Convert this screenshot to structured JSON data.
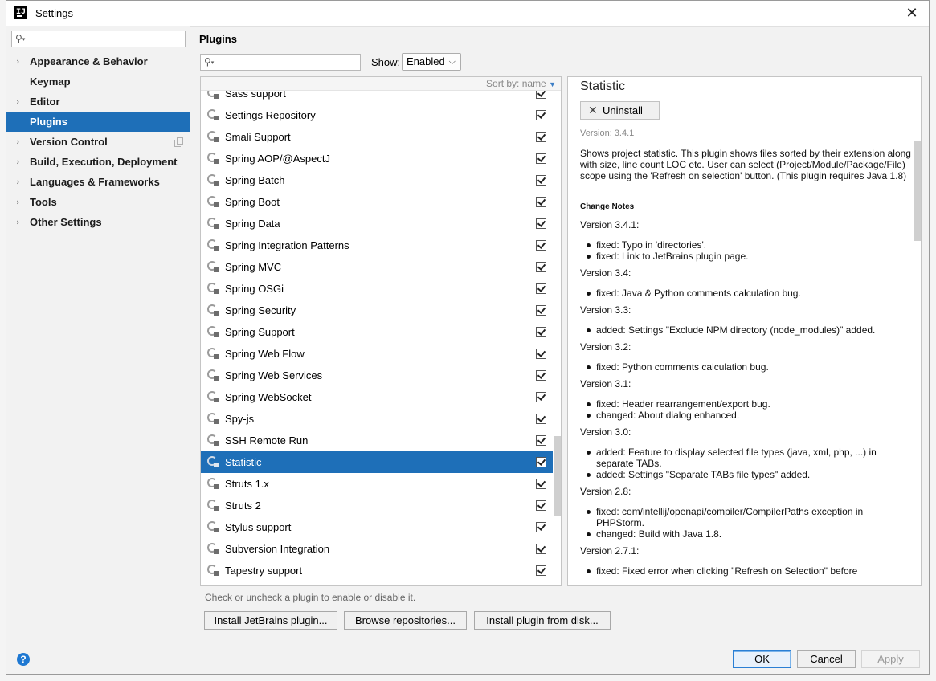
{
  "window": {
    "title": "Settings"
  },
  "sidebar": {
    "search_placeholder": "",
    "items": [
      {
        "label": "Appearance & Behavior",
        "expandable": true
      },
      {
        "label": "Keymap",
        "expandable": false
      },
      {
        "label": "Editor",
        "expandable": true
      },
      {
        "label": "Plugins",
        "expandable": false,
        "selected": true
      },
      {
        "label": "Version Control",
        "expandable": true
      },
      {
        "label": "Build, Execution, Deployment",
        "expandable": true
      },
      {
        "label": "Languages & Frameworks",
        "expandable": true
      },
      {
        "label": "Tools",
        "expandable": true
      },
      {
        "label": "Other Settings",
        "expandable": true
      }
    ]
  },
  "plugins": {
    "title": "Plugins",
    "search_placeholder": "",
    "show_label": "Show:",
    "show_value": "Enabled",
    "sort_label": "Sort by: name",
    "items": [
      {
        "name": "Sass support",
        "enabled": true
      },
      {
        "name": "Settings Repository",
        "enabled": true
      },
      {
        "name": "Smali Support",
        "enabled": true
      },
      {
        "name": "Spring AOP/@AspectJ",
        "enabled": true
      },
      {
        "name": "Spring Batch",
        "enabled": true
      },
      {
        "name": "Spring Boot",
        "enabled": true
      },
      {
        "name": "Spring Data",
        "enabled": true
      },
      {
        "name": "Spring Integration Patterns",
        "enabled": true
      },
      {
        "name": "Spring MVC",
        "enabled": true
      },
      {
        "name": "Spring OSGi",
        "enabled": true
      },
      {
        "name": "Spring Security",
        "enabled": true
      },
      {
        "name": "Spring Support",
        "enabled": true
      },
      {
        "name": "Spring Web Flow",
        "enabled": true
      },
      {
        "name": "Spring Web Services",
        "enabled": true
      },
      {
        "name": "Spring WebSocket",
        "enabled": true
      },
      {
        "name": "Spy-js",
        "enabled": true
      },
      {
        "name": "SSH Remote Run",
        "enabled": true
      },
      {
        "name": "Statistic",
        "enabled": true,
        "selected": true
      },
      {
        "name": "Struts 1.x",
        "enabled": true
      },
      {
        "name": "Struts 2",
        "enabled": true
      },
      {
        "name": "Stylus support",
        "enabled": true
      },
      {
        "name": "Subversion Integration",
        "enabled": true
      },
      {
        "name": "Tapestry support",
        "enabled": true
      }
    ],
    "hint": "Check or uncheck a plugin to enable or disable it.",
    "buttons": {
      "install_jetbrains": "Install JetBrains plugin...",
      "browse": "Browse repositories...",
      "install_disk": "Install plugin from disk..."
    }
  },
  "detail": {
    "title": "Statistic",
    "uninstall_label": "Uninstall",
    "version": "Version: 3.4.1",
    "description": "Shows project statistic. This plugin shows files sorted by their extension along with size, line count LOC etc. User can select (Project/Module/Package/File) scope using the 'Refresh on selection' button. (This plugin requires Java 1.8)",
    "change_notes_title": "Change Notes",
    "changes": [
      {
        "version": "Version 3.4.1:",
        "notes": [
          "fixed: Typo in 'directories'.",
          "fixed: Link to JetBrains plugin page."
        ]
      },
      {
        "version": "Version 3.4:",
        "notes": [
          "fixed: Java & Python comments calculation bug."
        ]
      },
      {
        "version": "Version 3.3:",
        "notes": [
          "added: Settings \"Exclude NPM directory (node_modules)\" added."
        ]
      },
      {
        "version": "Version 3.2:",
        "notes": [
          "fixed: Python comments calculation bug."
        ]
      },
      {
        "version": "Version 3.1:",
        "notes": [
          "fixed: Header rearrangement/export bug.",
          "changed: About dialog enhanced."
        ]
      },
      {
        "version": "Version 3.0:",
        "notes": [
          "added: Feature to display selected file types (java, xml, php, ...) in separate TABs.",
          "added: Settings \"Separate TABs file types\" added."
        ]
      },
      {
        "version": "Version 2.8:",
        "notes": [
          "fixed: com/intellij/openapi/compiler/CompilerPaths exception in PHPStorm.",
          "changed: Build with Java 1.8."
        ]
      },
      {
        "version": "Version 2.7.1:",
        "notes": [
          "fixed: Fixed error when clicking \"Refresh on Selection\" before"
        ]
      }
    ]
  },
  "footer": {
    "help_label": "?",
    "ok_label": "OK",
    "cancel_label": "Cancel",
    "apply_label": "Apply"
  }
}
